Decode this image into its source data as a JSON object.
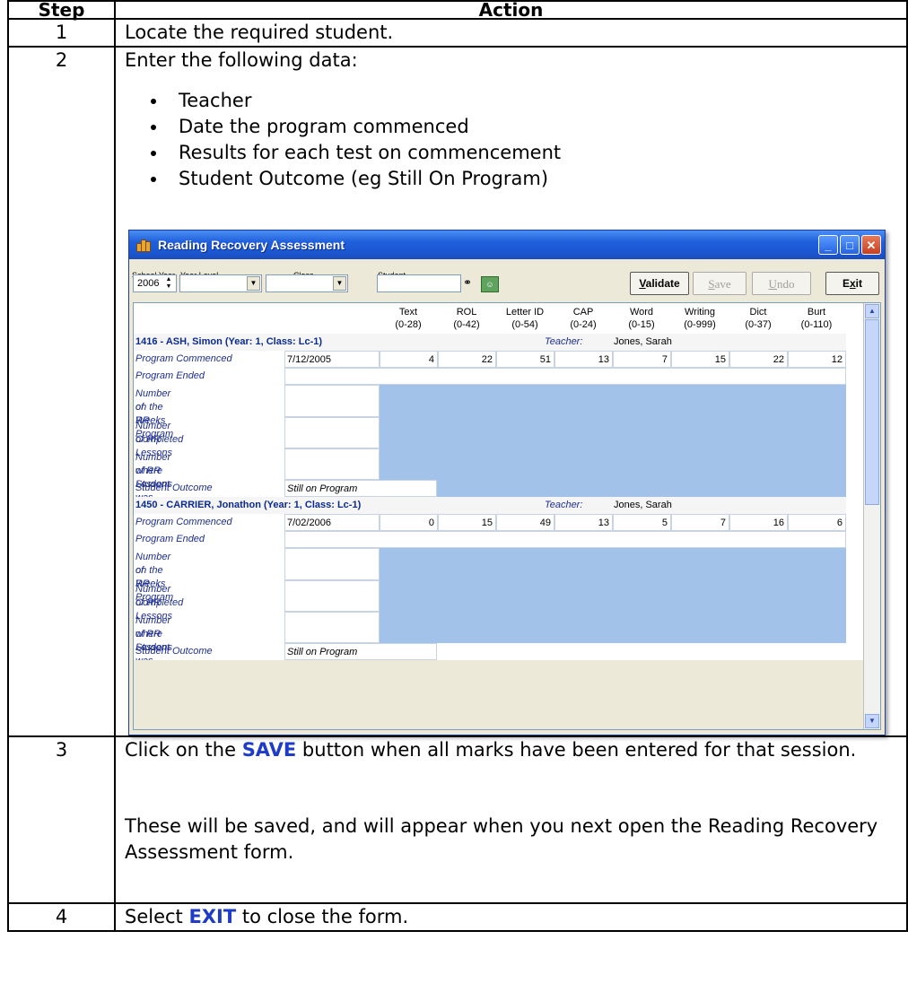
{
  "header": {
    "step": "Step",
    "action": "Action"
  },
  "steps": [
    {
      "num": "1",
      "text": "Locate the required student."
    },
    {
      "num": "2",
      "intro": "Enter the following data:",
      "bullets": [
        "Teacher",
        "Date the program commenced",
        "Results for each test on commencement",
        "Student Outcome (eg Still On Program)"
      ]
    },
    {
      "num": "3",
      "pre": "Click on the ",
      "highlight": "SAVE",
      "post": " button when all marks have been entered for that session.",
      "note": "These will be saved, and will appear when you next open the Reading Recovery Assessment form."
    },
    {
      "num": "4",
      "pre": "Select ",
      "highlight": "EXIT",
      "post": " to close the form."
    }
  ],
  "window": {
    "title": "Reading Recovery Assessment",
    "fields": {
      "school_year_label": "School Year",
      "school_year_value": "2006",
      "year_level_label": "Year Level",
      "class_label": "Class",
      "student_label": "Student"
    },
    "buttons": {
      "validate": "Validate",
      "save": "Save",
      "undo": "Undo",
      "exit": "Exit"
    },
    "columns": [
      {
        "name": "Text",
        "range": "(0-28)"
      },
      {
        "name": "ROL",
        "range": "(0-42)"
      },
      {
        "name": "Letter ID",
        "range": "(0-54)"
      },
      {
        "name": "CAP",
        "range": "(0-24)"
      },
      {
        "name": "Word",
        "range": "(0-15)"
      },
      {
        "name": "Writing",
        "range": "(0-999)"
      },
      {
        "name": "Dict",
        "range": "(0-37)"
      },
      {
        "name": "Burt",
        "range": "(0-110)"
      }
    ],
    "row_labels": {
      "commenced": "Program Commenced",
      "ended": "Program Ended",
      "weeks_1": "Number of Weeks",
      "weeks_2": "on the RR Program",
      "lessons_1": "Number of RR Lessons",
      "lessons_2": "Completed",
      "absent_1": "Number of RR Lessons",
      "absent_2": "where Student was Absent",
      "outcome": "Student Outcome"
    },
    "teacher_label": "Teacher:",
    "students": [
      {
        "heading": "1416 - ASH, Simon  (Year: 1,  Class: Lc-1)",
        "teacher": "Jones, Sarah",
        "commenced_date": "7/12/2005",
        "scores": [
          "4",
          "22",
          "51",
          "13",
          "7",
          "15",
          "22",
          "12"
        ],
        "outcome": "Still on Program"
      },
      {
        "heading": "1450 - CARRIER, Jonathon  (Year: 1,  Class: Lc-1)",
        "teacher": "Jones, Sarah",
        "commenced_date": "7/02/2006",
        "scores": [
          "0",
          "15",
          "49",
          "13",
          "5",
          "7",
          "16",
          "6"
        ],
        "outcome": "Still on Program"
      }
    ]
  }
}
